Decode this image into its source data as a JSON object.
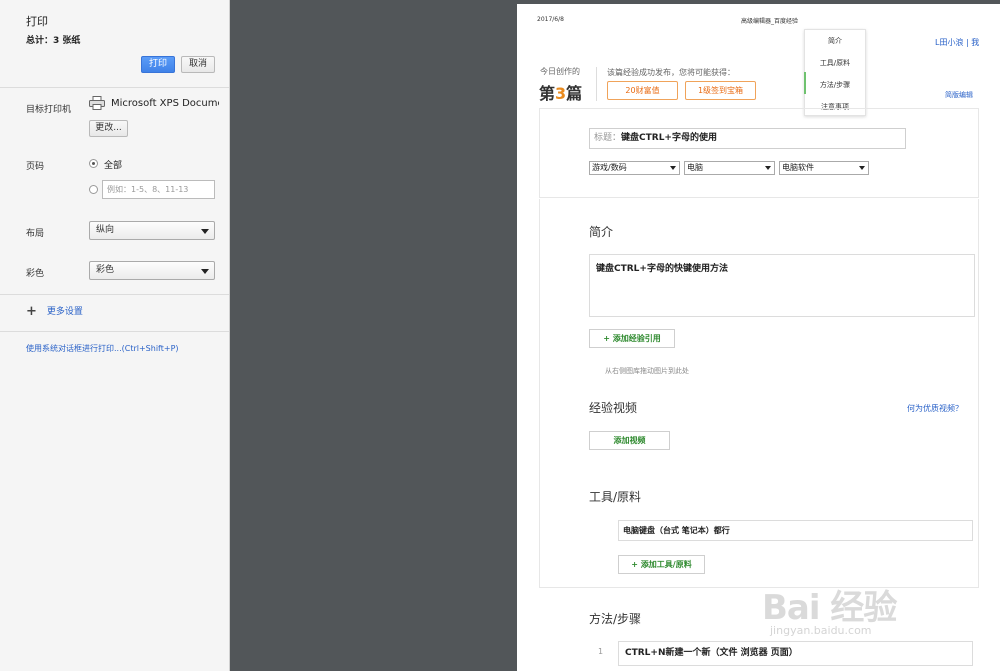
{
  "print_panel": {
    "title": "打印",
    "total": "总计：3 张纸",
    "print_button": "打印",
    "cancel_button": "取消",
    "destination_label": "目标打印机",
    "destination_name": "Microsoft XPS Documen...",
    "change_button": "更改...",
    "pages_label": "页码",
    "pages_all": "全部",
    "pages_custom_placeholder": "例如：1-5、8、11-13",
    "layout_label": "布局",
    "layout_value": "纵向",
    "color_label": "彩色",
    "color_value": "彩色",
    "more_settings": "更多设置",
    "system_dialog_link": "使用系统对话框进行打印...(Ctrl+Shift+P)"
  },
  "preview": {
    "header_date": "2017/6/8",
    "header_title": "高级编辑器_百度经验",
    "dropdown_menu": [
      "简介",
      "工具/原料",
      "方法/步骤",
      "注意事项"
    ],
    "user_link": "L田小浪 | 我",
    "today_label": "今日创作的",
    "today_count_prefix": "第",
    "today_count_num": "3",
    "today_count_suffix": "篇",
    "success_text": "该篇经验成功发布，您将可能获得：",
    "reward_1": "20财富值",
    "reward_2": "1级签到宝箱",
    "simple_editor_link": "简版编辑",
    "title_prefix": "标题：",
    "title_value": "键盘CTRL+字母的使用",
    "category_1": "游戏/数码",
    "category_2": "电脑",
    "category_3": "电脑软件",
    "intro_heading": "简介",
    "intro_text": "键盘CTRL+字母的快键使用方法",
    "add_quote_button": "+ 添加经验引用",
    "drag_hint": "从右侧图库拖动图片到此处",
    "video_heading": "经验视频",
    "video_question": "何为优质视频？",
    "add_video_button": "添加视频",
    "tools_heading": "工具/原料",
    "tools_item": "电脑键盘（台式 笔记本）都行",
    "add_tools_button": "+ 添加工具/原料",
    "steps_heading": "方法/步骤",
    "step_number": "1",
    "step_text": "CTRL+N新建一个新（文件 浏览器 页面）"
  },
  "watermark": {
    "brand": "Bai 经验",
    "url": "jingyan.baidu.com"
  }
}
